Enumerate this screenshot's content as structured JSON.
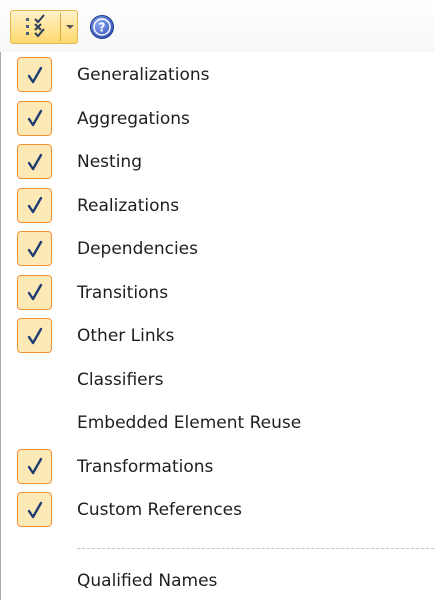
{
  "toolbar": {
    "main_icon": "checklist-icon",
    "dropdown_icon": "chevron-down-icon",
    "help_icon": "help-icon",
    "accent": "#ffd86e"
  },
  "menu": {
    "items": [
      {
        "label": "Generalizations",
        "checked": true
      },
      {
        "label": "Aggregations",
        "checked": true
      },
      {
        "label": "Nesting",
        "checked": true
      },
      {
        "label": "Realizations",
        "checked": true
      },
      {
        "label": "Dependencies",
        "checked": true
      },
      {
        "label": "Transitions",
        "checked": true
      },
      {
        "label": "Other Links",
        "checked": true
      },
      {
        "label": "Classifiers",
        "checked": false
      },
      {
        "label": "Embedded Element Reuse",
        "checked": false
      },
      {
        "label": "Transformations",
        "checked": true
      },
      {
        "label": "Custom References",
        "checked": true
      },
      {
        "label": "Qualified Names",
        "checked": false
      }
    ],
    "check_color": "#f29436",
    "check_fill": "#fde9b5",
    "checkmark_color": "#1f3c73"
  }
}
